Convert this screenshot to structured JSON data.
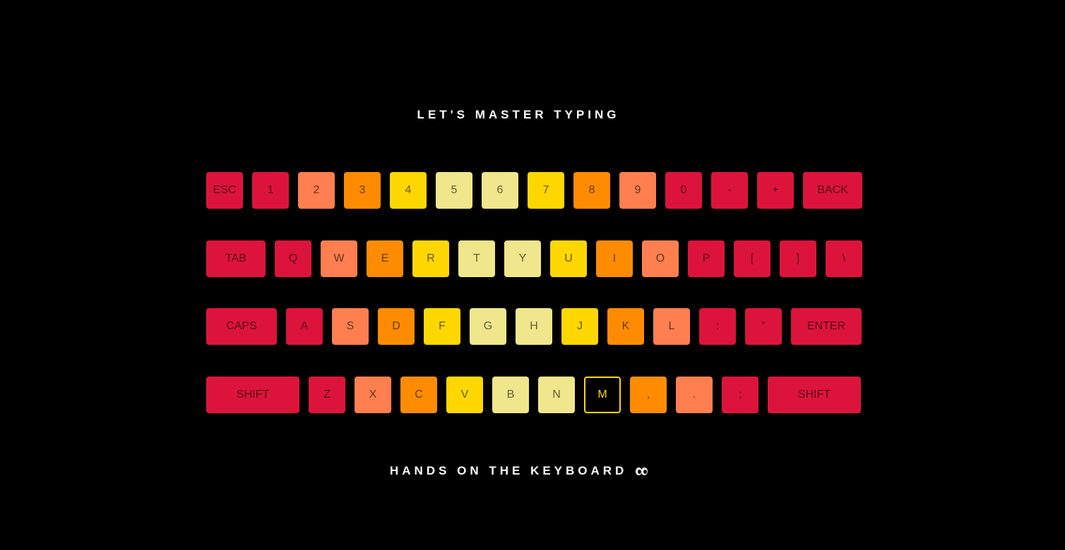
{
  "title": "LET'S MASTER TYPING",
  "footer": "HANDS ON THE KEYBOARD",
  "footer_icon": "eyes-icon",
  "colors": {
    "background": "#000000",
    "red": "#dc143c",
    "coral": "#ff7f50",
    "orange": "#ff8c00",
    "gold": "#ffd700",
    "khaki": "#f0e68c",
    "active_border": "#ffd700"
  },
  "active_key": "M",
  "rows": [
    [
      {
        "label": "ESC",
        "color": "red"
      },
      {
        "label": "1",
        "color": "red"
      },
      {
        "label": "2",
        "color": "coral"
      },
      {
        "label": "3",
        "color": "orange"
      },
      {
        "label": "4",
        "color": "gold"
      },
      {
        "label": "5",
        "color": "khaki"
      },
      {
        "label": "6",
        "color": "khaki"
      },
      {
        "label": "7",
        "color": "gold"
      },
      {
        "label": "8",
        "color": "orange"
      },
      {
        "label": "9",
        "color": "coral"
      },
      {
        "label": "0",
        "color": "red"
      },
      {
        "label": "-",
        "color": "red"
      },
      {
        "label": "+",
        "color": "red"
      },
      {
        "label": "BACK",
        "color": "red"
      }
    ],
    [
      {
        "label": "TAB",
        "color": "red"
      },
      {
        "label": "Q",
        "color": "red"
      },
      {
        "label": "W",
        "color": "coral"
      },
      {
        "label": "E",
        "color": "orange"
      },
      {
        "label": "R",
        "color": "gold"
      },
      {
        "label": "T",
        "color": "khaki"
      },
      {
        "label": "Y",
        "color": "khaki"
      },
      {
        "label": "U",
        "color": "gold"
      },
      {
        "label": "I",
        "color": "orange"
      },
      {
        "label": "O",
        "color": "coral"
      },
      {
        "label": "P",
        "color": "red"
      },
      {
        "label": "[",
        "color": "red"
      },
      {
        "label": "]",
        "color": "red"
      },
      {
        "label": "\\",
        "color": "red"
      }
    ],
    [
      {
        "label": "CAPS",
        "color": "red"
      },
      {
        "label": "A",
        "color": "red"
      },
      {
        "label": "S",
        "color": "coral"
      },
      {
        "label": "D",
        "color": "orange"
      },
      {
        "label": "F",
        "color": "gold"
      },
      {
        "label": "G",
        "color": "khaki"
      },
      {
        "label": "H",
        "color": "khaki"
      },
      {
        "label": "J",
        "color": "gold"
      },
      {
        "label": "K",
        "color": "orange"
      },
      {
        "label": "L",
        "color": "coral"
      },
      {
        "label": ":",
        "color": "red"
      },
      {
        "label": "\"",
        "color": "red"
      },
      {
        "label": "ENTER",
        "color": "red"
      }
    ],
    [
      {
        "label": "SHIFT",
        "color": "red"
      },
      {
        "label": "Z",
        "color": "red"
      },
      {
        "label": "X",
        "color": "coral"
      },
      {
        "label": "C",
        "color": "orange"
      },
      {
        "label": "V",
        "color": "gold"
      },
      {
        "label": "B",
        "color": "khaki"
      },
      {
        "label": "N",
        "color": "khaki"
      },
      {
        "label": "M",
        "color": "gold"
      },
      {
        "label": ",",
        "color": "orange"
      },
      {
        "label": ".",
        "color": "coral"
      },
      {
        "label": ";",
        "color": "red"
      },
      {
        "label": "SHIFT",
        "color": "red"
      }
    ]
  ]
}
